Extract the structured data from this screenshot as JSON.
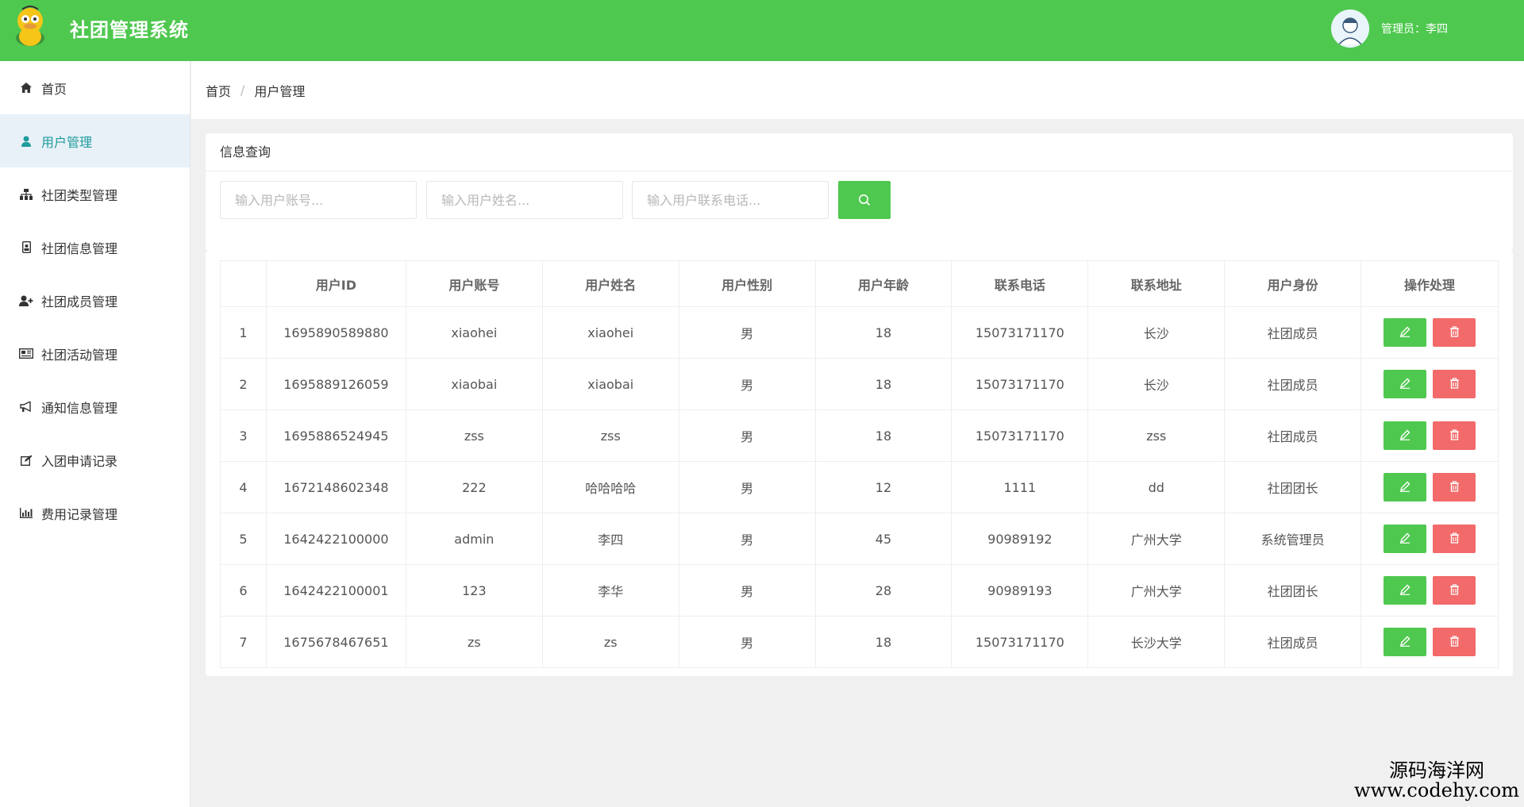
{
  "app": {
    "title": "社团管理系统",
    "admin_label": "管理员：李四"
  },
  "sidebar": {
    "items": [
      {
        "label": "首页",
        "icon": "home-icon",
        "active": false
      },
      {
        "label": "用户管理",
        "icon": "user-icon",
        "active": true
      },
      {
        "label": "社团类型管理",
        "icon": "sitemap-icon",
        "active": false
      },
      {
        "label": "社团信息管理",
        "icon": "id-badge-icon",
        "active": false
      },
      {
        "label": "社团成员管理",
        "icon": "user-plus-icon",
        "active": false
      },
      {
        "label": "社团活动管理",
        "icon": "newspaper-icon",
        "active": false
      },
      {
        "label": "通知信息管理",
        "icon": "bullhorn-icon",
        "active": false
      },
      {
        "label": "入团申请记录",
        "icon": "edit-icon",
        "active": false
      },
      {
        "label": "费用记录管理",
        "icon": "bar-chart-icon",
        "active": false
      }
    ]
  },
  "breadcrumb": {
    "home": "首页",
    "separator": "/",
    "current": "用户管理"
  },
  "query": {
    "title": "信息查询",
    "account_placeholder": "输入用户账号...",
    "name_placeholder": "输入用户姓名...",
    "phone_placeholder": "输入用户联系电话...",
    "search_icon": "search-icon"
  },
  "table": {
    "headers": [
      "",
      "用户ID",
      "用户账号",
      "用户姓名",
      "用户性别",
      "用户年龄",
      "联系电话",
      "联系地址",
      "用户身份",
      "操作处理"
    ],
    "rows": [
      [
        "1",
        "1695890589880",
        "xiaohei",
        "xiaohei",
        "男",
        "18",
        "15073171170",
        "长沙",
        "社团成员"
      ],
      [
        "2",
        "1695889126059",
        "xiaobai",
        "xiaobai",
        "男",
        "18",
        "15073171170",
        "长沙",
        "社团成员"
      ],
      [
        "3",
        "1695886524945",
        "zss",
        "zss",
        "男",
        "18",
        "15073171170",
        "zss",
        "社团成员"
      ],
      [
        "4",
        "1672148602348",
        "222",
        "哈哈哈哈",
        "男",
        "12",
        "1111",
        "dd",
        "社团团长"
      ],
      [
        "5",
        "1642422100000",
        "admin",
        "李四",
        "男",
        "45",
        "90989192",
        "广州大学",
        "系统管理员"
      ],
      [
        "6",
        "1642422100001",
        "123",
        "李华",
        "男",
        "28",
        "90989193",
        "广州大学",
        "社团团长"
      ],
      [
        "7",
        "1675678467651",
        "zs",
        "zs",
        "男",
        "18",
        "15073171170",
        "长沙大学",
        "社团成员"
      ]
    ]
  },
  "colors": {
    "primary": "#4fc84f",
    "danger": "#f26a6a",
    "active_bg": "#e8f1f8",
    "active_text": "#1e9b9b"
  },
  "watermark": {
    "line1": "源码海洋网",
    "line2": "www.codehy.com"
  }
}
